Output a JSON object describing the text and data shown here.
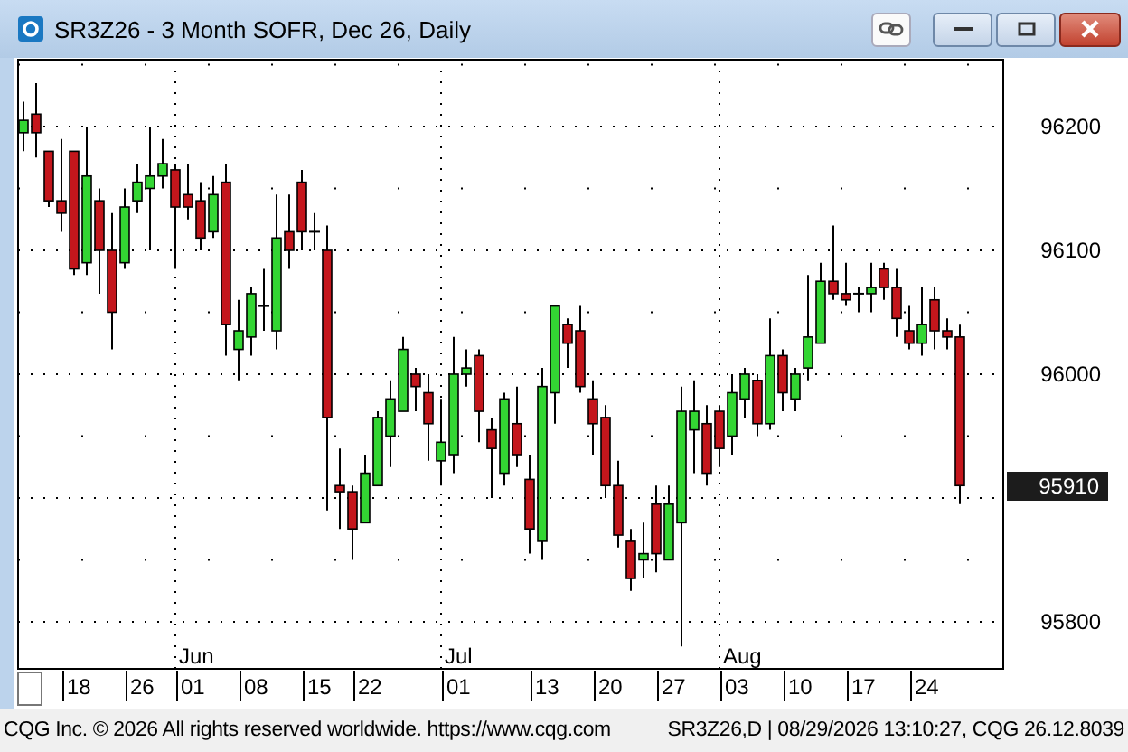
{
  "window": {
    "title": "SR3Z26 - 3 Month SOFR, Dec 26, Daily"
  },
  "chart": {
    "last_price": "95910",
    "months": [
      "Jun",
      "Jul",
      "Aug"
    ],
    "dates": [
      "18",
      "26",
      "01",
      "08",
      "15",
      "22",
      "01",
      "13",
      "20",
      "27",
      "03",
      "10",
      "17",
      "24"
    ],
    "chart_data": {
      "type": "candlestick",
      "grid": true,
      "ylim": [
        95762,
        96254
      ],
      "yticks": [
        96200,
        96100,
        96000,
        95800
      ],
      "ohlc": [
        [
          96195,
          96220,
          96180,
          96205
        ],
        [
          96210,
          96235,
          96175,
          96195
        ],
        [
          96180,
          96180,
          96135,
          96140
        ],
        [
          96140,
          96190,
          96115,
          96130
        ],
        [
          96180,
          96180,
          96080,
          96085
        ],
        [
          96090,
          96200,
          96080,
          96160
        ],
        [
          96140,
          96150,
          96065,
          96100
        ],
        [
          96100,
          96130,
          96020,
          96050
        ],
        [
          96090,
          96150,
          96085,
          96135
        ],
        [
          96140,
          96170,
          96130,
          96155
        ],
        [
          96150,
          96200,
          96100,
          96160
        ],
        [
          96160,
          96190,
          96150,
          96170
        ],
        [
          96165,
          96170,
          96085,
          96135
        ],
        [
          96145,
          96170,
          96125,
          96135
        ],
        [
          96140,
          96155,
          96100,
          96110
        ],
        [
          96115,
          96160,
          96110,
          96145
        ],
        [
          96155,
          96170,
          96015,
          96040
        ],
        [
          96020,
          96060,
          95995,
          96035
        ],
        [
          96030,
          96070,
          96015,
          96065
        ],
        [
          96055,
          96085,
          96035,
          96055
        ],
        [
          96035,
          96145,
          96020,
          96110
        ],
        [
          96115,
          96145,
          96085,
          96100
        ],
        [
          96155,
          96165,
          96100,
          96115
        ],
        [
          96115,
          96130,
          96100,
          96115
        ],
        [
          96100,
          96120,
          95890,
          95965
        ],
        [
          95910,
          95940,
          95875,
          95905
        ],
        [
          95905,
          95910,
          95850,
          95875
        ],
        [
          95880,
          95935,
          95880,
          95920
        ],
        [
          95910,
          95970,
          95910,
          95965
        ],
        [
          95950,
          95995,
          95925,
          95980
        ],
        [
          95970,
          96030,
          95970,
          96020
        ],
        [
          96000,
          96005,
          95970,
          95990
        ],
        [
          95985,
          96000,
          95930,
          95960
        ],
        [
          95930,
          95980,
          95910,
          95945
        ],
        [
          95935,
          96030,
          95920,
          96000
        ],
        [
          96000,
          96020,
          95990,
          96005
        ],
        [
          96015,
          96020,
          95945,
          95970
        ],
        [
          95955,
          95965,
          95900,
          95940
        ],
        [
          95920,
          95985,
          95910,
          95980
        ],
        [
          95960,
          95990,
          95925,
          95935
        ],
        [
          95915,
          95935,
          95855,
          95875
        ],
        [
          95865,
          96005,
          95850,
          95990
        ],
        [
          95985,
          96055,
          95960,
          96055
        ],
        [
          96040,
          96045,
          96005,
          96025
        ],
        [
          96035,
          96055,
          95985,
          95990
        ],
        [
          95980,
          95995,
          95935,
          95960
        ],
        [
          95965,
          95975,
          95900,
          95910
        ],
        [
          95910,
          95930,
          95860,
          95870
        ],
        [
          95865,
          95875,
          95825,
          95835
        ],
        [
          95850,
          95880,
          95835,
          95855
        ],
        [
          95895,
          95910,
          95840,
          95855
        ],
        [
          95850,
          95910,
          95850,
          95895
        ],
        [
          95880,
          95990,
          95780,
          95970
        ],
        [
          95955,
          95995,
          95920,
          95970
        ],
        [
          95960,
          95975,
          95910,
          95920
        ],
        [
          95970,
          95975,
          95925,
          95940
        ],
        [
          95950,
          96000,
          95935,
          95985
        ],
        [
          95980,
          96005,
          95965,
          96000
        ],
        [
          95995,
          96000,
          95950,
          95960
        ],
        [
          95960,
          96045,
          95955,
          96015
        ],
        [
          96015,
          96020,
          95970,
          95985
        ],
        [
          95980,
          96005,
          95970,
          96000
        ],
        [
          96005,
          96080,
          95995,
          96030
        ],
        [
          96025,
          96090,
          96025,
          96075
        ],
        [
          96075,
          96120,
          96060,
          96065
        ],
        [
          96065,
          96090,
          96055,
          96060
        ],
        [
          96065,
          96070,
          96050,
          96065
        ],
        [
          96065,
          96090,
          96050,
          96070
        ],
        [
          96085,
          96090,
          96060,
          96070
        ],
        [
          96070,
          96085,
          96030,
          96045
        ],
        [
          96035,
          96055,
          96020,
          96025
        ],
        [
          96025,
          96070,
          96015,
          96040
        ],
        [
          96060,
          96070,
          96020,
          96035
        ],
        [
          96035,
          96045,
          96020,
          96030
        ],
        [
          96030,
          96040,
          95895,
          95910
        ]
      ]
    }
  },
  "status_bar": {
    "left": "CQG Inc. © 2026 All rights reserved worldwide. https://www.cqg.com",
    "right": "SR3Z26,D | 08/29/2026 13:10:27, CQG 26.12.8039"
  }
}
